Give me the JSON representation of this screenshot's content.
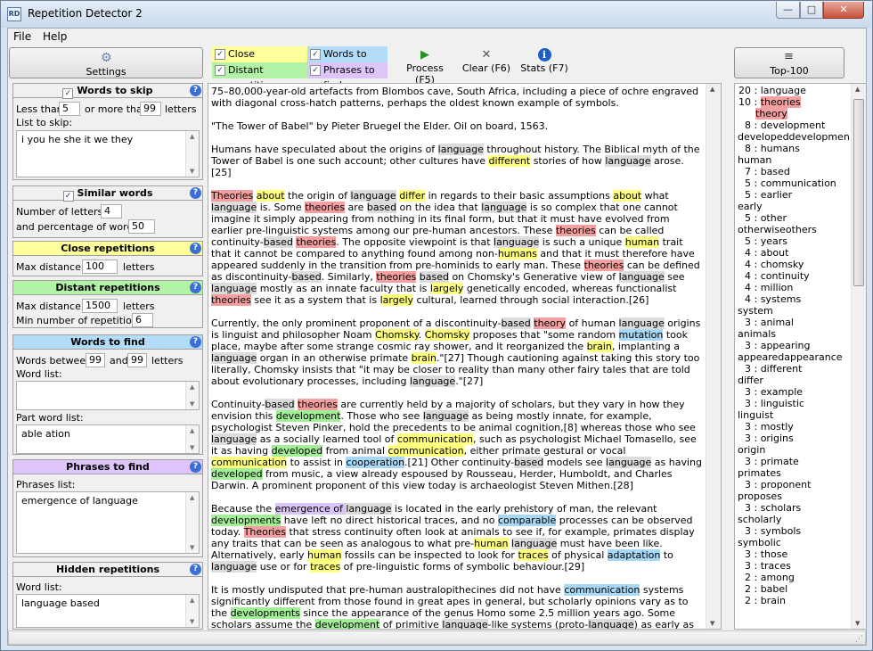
{
  "window": {
    "title": "Repetition Detector 2"
  },
  "menu": {
    "file": "File",
    "help": "Help"
  },
  "toolbar": {
    "settings": "Settings",
    "close_repetitions": "Close repetitions",
    "distant_repetitions": "Distant repetitions",
    "words_to_find": "Words to find",
    "phrases_to_find": "Phrases to find",
    "process": "Process (F5)",
    "clear": "Clear (F6)",
    "stats": "Stats (F7)",
    "top100": "Top-100"
  },
  "panels": {
    "words_to_skip": {
      "title": "Words to skip",
      "less_than": "Less than",
      "less_value": "5",
      "or_more_than": "or more than",
      "more_value": "99",
      "letters": "letters",
      "list_label": "List to skip:",
      "list_value": "i you he she it we they"
    },
    "similar_words": {
      "title": "Similar words",
      "num_letters_label": "Number of letters:",
      "num_letters": "4",
      "percentage_label": "and percentage of word:",
      "percentage": "50"
    },
    "close_repetitions": {
      "title": "Close repetitions",
      "max_distance_label": "Max distance:",
      "max_distance": "100",
      "letters": "letters"
    },
    "distant_repetitions": {
      "title": "Distant repetitions",
      "max_distance_label": "Max distance:",
      "max_distance": "1500",
      "letters": "letters",
      "min_label": "Min number of repetitions:",
      "min_value": "6"
    },
    "words_to_find": {
      "title": "Words to find",
      "between_label": "Words between",
      "from": "99",
      "and": "and",
      "to": "99",
      "letters": "letters",
      "word_list_label": "Word list:",
      "word_list": "",
      "part_list_label": "Part word list:",
      "part_list": "able ation"
    },
    "phrases_to_find": {
      "title": "Phrases to find",
      "list_label": "Phrases list:",
      "list_value": "emergence of language"
    },
    "hidden_repetitions": {
      "title": "Hidden repetitions",
      "list_label": "Word list:",
      "list_value": "language based"
    }
  },
  "top100": [
    {
      "count": "20",
      "word": "language",
      "variants": []
    },
    {
      "count": "10",
      "word": "theories",
      "variants": [
        "theory"
      ],
      "hl": "t"
    },
    {
      "count": "8",
      "word": "development",
      "variants": [
        "developed",
        "developments"
      ]
    },
    {
      "count": "8",
      "word": "humans",
      "variants": [
        "human"
      ]
    },
    {
      "count": "7",
      "word": "based",
      "variants": []
    },
    {
      "count": "5",
      "word": "communication",
      "variants": []
    },
    {
      "count": "5",
      "word": "earlier",
      "variants": [
        "early"
      ]
    },
    {
      "count": "5",
      "word": "other",
      "variants": [
        "otherwise",
        "others"
      ]
    },
    {
      "count": "5",
      "word": "years",
      "variants": []
    },
    {
      "count": "4",
      "word": "about",
      "variants": []
    },
    {
      "count": "4",
      "word": "chomsky",
      "variants": []
    },
    {
      "count": "4",
      "word": "continuity",
      "variants": []
    },
    {
      "count": "4",
      "word": "million",
      "variants": []
    },
    {
      "count": "4",
      "word": "systems",
      "variants": [
        "system"
      ]
    },
    {
      "count": "3",
      "word": "animal",
      "variants": [
        "animals"
      ]
    },
    {
      "count": "3",
      "word": "appearing",
      "variants": [
        "appeared",
        "appearance"
      ]
    },
    {
      "count": "3",
      "word": "different",
      "variants": [
        "differ"
      ]
    },
    {
      "count": "3",
      "word": "example",
      "variants": []
    },
    {
      "count": "3",
      "word": "linguistic",
      "variants": [
        "linguist"
      ]
    },
    {
      "count": "3",
      "word": "mostly",
      "variants": []
    },
    {
      "count": "3",
      "word": "origins",
      "variants": [
        "origin"
      ]
    },
    {
      "count": "3",
      "word": "primate",
      "variants": [
        "primates"
      ]
    },
    {
      "count": "3",
      "word": "proponent",
      "variants": [
        "proposes"
      ]
    },
    {
      "count": "3",
      "word": "scholars",
      "variants": [
        "scholarly"
      ]
    },
    {
      "count": "3",
      "word": "symbols",
      "variants": [
        "symbolic"
      ]
    },
    {
      "count": "3",
      "word": "those",
      "variants": []
    },
    {
      "count": "3",
      "word": "traces",
      "variants": []
    },
    {
      "count": "2",
      "word": "among",
      "variants": []
    },
    {
      "count": "2",
      "word": "babel",
      "variants": []
    },
    {
      "count": "2",
      "word": "brain",
      "variants": []
    }
  ]
}
